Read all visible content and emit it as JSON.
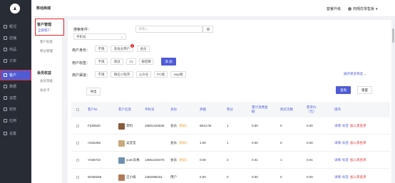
{
  "app": {
    "logo_glyph": "♟",
    "title": "移动商城"
  },
  "header": {
    "upgrade": "套餐升级",
    "shop": "商翔优零售板",
    "caret": "▾"
  },
  "sidebar": {
    "items": [
      {
        "label": "概况"
      },
      {
        "label": "店铺"
      },
      {
        "label": "商品"
      },
      {
        "label": "订单"
      },
      {
        "label": "客户"
      },
      {
        "label": "数据"
      },
      {
        "label": "运营"
      },
      {
        "label": "财务"
      },
      {
        "label": "应用"
      },
      {
        "label": "设置"
      }
    ]
  },
  "submenu": {
    "group1": "客户管理",
    "items1": [
      "全部客户",
      "客户标签",
      "积分管理"
    ],
    "group2": "会员权益",
    "items2": [
      "会员等级",
      "会员卡"
    ]
  },
  "filters": {
    "search_label": "搜索条件：",
    "search_type": "手机号",
    "search_placeholder": "请输入",
    "identity_label": "用户身份：",
    "identity_tags": [
      "不限",
      "非会员用户",
      "会员"
    ],
    "identity_badge": "1",
    "tag_label": "用户标签：",
    "tag_tags": [
      "不限",
      "测试",
      "V1",
      "要结算"
    ],
    "add_label": "添 加",
    "source_label": "用户渠道：",
    "source_tags": [
      "不限",
      "微信小程序",
      "公众号",
      "PC端",
      "wap端"
    ],
    "expand_link": "展开更多筛选 ⌄",
    "search_button": "查询",
    "reset_button": "重置",
    "export_button": "导出"
  },
  "table": {
    "headers": [
      "客户ID",
      "客户信息",
      "手机号",
      "身份",
      "余额",
      "积分",
      "累计消费金额",
      "购买次数",
      "客单价（元）",
      "操作"
    ],
    "rows": [
      {
        "id": "F330520",
        "name": "李利",
        "phone": "18801433945",
        "identity": "会员",
        "level": "测试1",
        "balance": "9812.00",
        "points": "1",
        "spent": "0.00",
        "orders": "0",
        "price": "0.00"
      },
      {
        "id": "A332266",
        "name": "吴莹莹",
        "phone": "",
        "identity": "会员",
        "level": "测试1",
        "balance": "1.00",
        "points": "1",
        "spent": "0.00",
        "orders": "0",
        "price": "0.00"
      },
      {
        "id": "Y336722",
        "name": "yuen东格",
        "phone": "13861226475",
        "identity": "会员",
        "level": "测试1",
        "balance": "0.00",
        "points": "2",
        "spent": "0.01",
        "orders": "1",
        "price": "0.01"
      },
      {
        "id": "W336256",
        "name": "王小绮",
        "phone": "1352096161",
        "identity": "用户",
        "level": "",
        "balance": "0.00",
        "points": "0",
        "spent": "0.00",
        "orders": "0",
        "price": "0.00"
      }
    ],
    "ops": [
      "详情",
      "标签",
      "加入黑名单"
    ]
  },
  "colors": {
    "primary": "#4f5bd5",
    "danger": "#e6262d",
    "sidebar": "#282c34"
  }
}
